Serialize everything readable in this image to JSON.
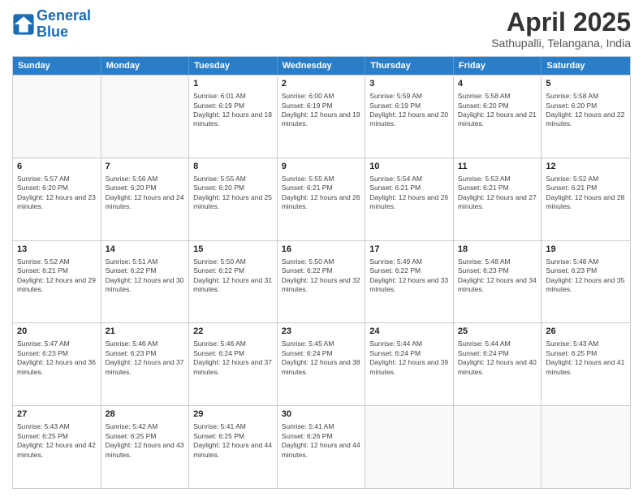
{
  "header": {
    "logo_line1": "General",
    "logo_line2": "Blue",
    "title": "April 2025",
    "subtitle": "Sathupalli, Telangana, India"
  },
  "weekdays": [
    "Sunday",
    "Monday",
    "Tuesday",
    "Wednesday",
    "Thursday",
    "Friday",
    "Saturday"
  ],
  "rows": [
    [
      {
        "day": "",
        "info": ""
      },
      {
        "day": "",
        "info": ""
      },
      {
        "day": "1",
        "info": "Sunrise: 6:01 AM\nSunset: 6:19 PM\nDaylight: 12 hours and 18 minutes."
      },
      {
        "day": "2",
        "info": "Sunrise: 6:00 AM\nSunset: 6:19 PM\nDaylight: 12 hours and 19 minutes."
      },
      {
        "day": "3",
        "info": "Sunrise: 5:59 AM\nSunset: 6:19 PM\nDaylight: 12 hours and 20 minutes."
      },
      {
        "day": "4",
        "info": "Sunrise: 5:58 AM\nSunset: 6:20 PM\nDaylight: 12 hours and 21 minutes."
      },
      {
        "day": "5",
        "info": "Sunrise: 5:58 AM\nSunset: 6:20 PM\nDaylight: 12 hours and 22 minutes."
      }
    ],
    [
      {
        "day": "6",
        "info": "Sunrise: 5:57 AM\nSunset: 6:20 PM\nDaylight: 12 hours and 23 minutes."
      },
      {
        "day": "7",
        "info": "Sunrise: 5:56 AM\nSunset: 6:20 PM\nDaylight: 12 hours and 24 minutes."
      },
      {
        "day": "8",
        "info": "Sunrise: 5:55 AM\nSunset: 6:20 PM\nDaylight: 12 hours and 25 minutes."
      },
      {
        "day": "9",
        "info": "Sunrise: 5:55 AM\nSunset: 6:21 PM\nDaylight: 12 hours and 26 minutes."
      },
      {
        "day": "10",
        "info": "Sunrise: 5:54 AM\nSunset: 6:21 PM\nDaylight: 12 hours and 26 minutes."
      },
      {
        "day": "11",
        "info": "Sunrise: 5:53 AM\nSunset: 6:21 PM\nDaylight: 12 hours and 27 minutes."
      },
      {
        "day": "12",
        "info": "Sunrise: 5:52 AM\nSunset: 6:21 PM\nDaylight: 12 hours and 28 minutes."
      }
    ],
    [
      {
        "day": "13",
        "info": "Sunrise: 5:52 AM\nSunset: 6:21 PM\nDaylight: 12 hours and 29 minutes."
      },
      {
        "day": "14",
        "info": "Sunrise: 5:51 AM\nSunset: 6:22 PM\nDaylight: 12 hours and 30 minutes."
      },
      {
        "day": "15",
        "info": "Sunrise: 5:50 AM\nSunset: 6:22 PM\nDaylight: 12 hours and 31 minutes."
      },
      {
        "day": "16",
        "info": "Sunrise: 5:50 AM\nSunset: 6:22 PM\nDaylight: 12 hours and 32 minutes."
      },
      {
        "day": "17",
        "info": "Sunrise: 5:49 AM\nSunset: 6:22 PM\nDaylight: 12 hours and 33 minutes."
      },
      {
        "day": "18",
        "info": "Sunrise: 5:48 AM\nSunset: 6:23 PM\nDaylight: 12 hours and 34 minutes."
      },
      {
        "day": "19",
        "info": "Sunrise: 5:48 AM\nSunset: 6:23 PM\nDaylight: 12 hours and 35 minutes."
      }
    ],
    [
      {
        "day": "20",
        "info": "Sunrise: 5:47 AM\nSunset: 6:23 PM\nDaylight: 12 hours and 36 minutes."
      },
      {
        "day": "21",
        "info": "Sunrise: 5:46 AM\nSunset: 6:23 PM\nDaylight: 12 hours and 37 minutes."
      },
      {
        "day": "22",
        "info": "Sunrise: 5:46 AM\nSunset: 6:24 PM\nDaylight: 12 hours and 37 minutes."
      },
      {
        "day": "23",
        "info": "Sunrise: 5:45 AM\nSunset: 6:24 PM\nDaylight: 12 hours and 38 minutes."
      },
      {
        "day": "24",
        "info": "Sunrise: 5:44 AM\nSunset: 6:24 PM\nDaylight: 12 hours and 39 minutes."
      },
      {
        "day": "25",
        "info": "Sunrise: 5:44 AM\nSunset: 6:24 PM\nDaylight: 12 hours and 40 minutes."
      },
      {
        "day": "26",
        "info": "Sunrise: 5:43 AM\nSunset: 6:25 PM\nDaylight: 12 hours and 41 minutes."
      }
    ],
    [
      {
        "day": "27",
        "info": "Sunrise: 5:43 AM\nSunset: 6:25 PM\nDaylight: 12 hours and 42 minutes."
      },
      {
        "day": "28",
        "info": "Sunrise: 5:42 AM\nSunset: 6:25 PM\nDaylight: 12 hours and 43 minutes."
      },
      {
        "day": "29",
        "info": "Sunrise: 5:41 AM\nSunset: 6:25 PM\nDaylight: 12 hours and 44 minutes."
      },
      {
        "day": "30",
        "info": "Sunrise: 5:41 AM\nSunset: 6:26 PM\nDaylight: 12 hours and 44 minutes."
      },
      {
        "day": "",
        "info": ""
      },
      {
        "day": "",
        "info": ""
      },
      {
        "day": "",
        "info": ""
      }
    ]
  ]
}
